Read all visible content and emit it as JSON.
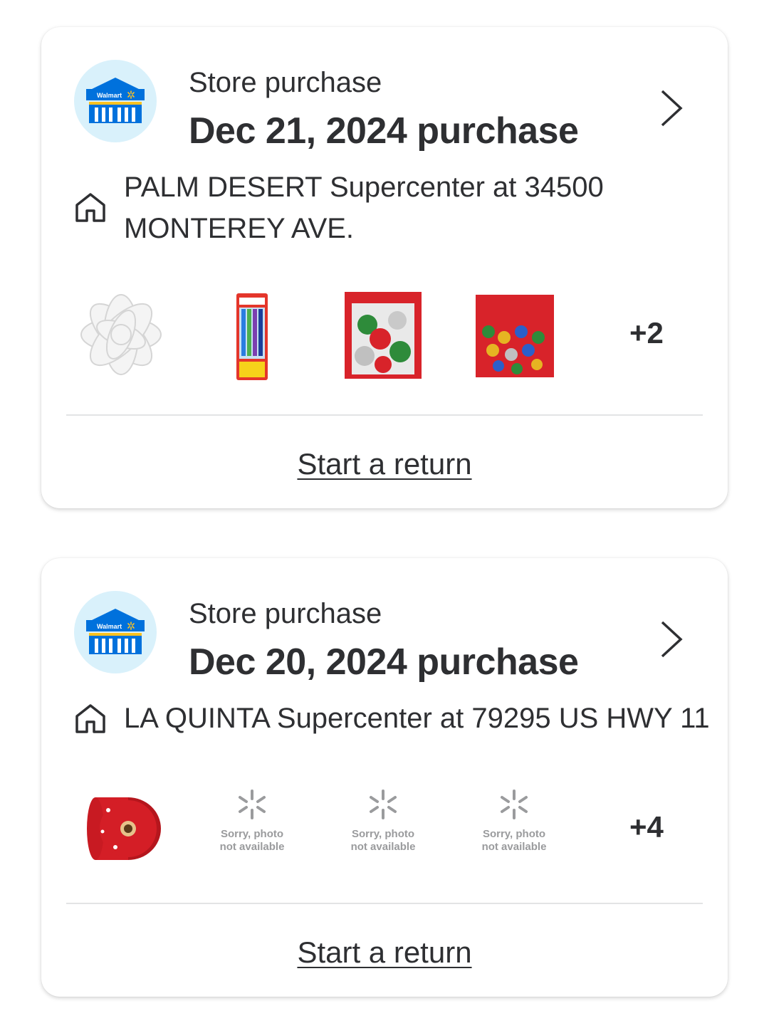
{
  "purchases": [
    {
      "type_label": "Store purchase",
      "title": "Dec 21, 2024 purchase",
      "store_address": "PALM DESERT Supercenter at 34500 MONTEREY AVE.",
      "store_logo_text": "Walmart",
      "items": [
        {
          "kind": "photo",
          "icon": "white-gift-bow-image"
        },
        {
          "kind": "photo",
          "icon": "toothbrush-pack-image"
        },
        {
          "kind": "photo",
          "icon": "gift-bows-bag-image"
        },
        {
          "kind": "photo",
          "icon": "gift-bows-bag-image"
        }
      ],
      "more_items": "+2",
      "return_label": "Start a return"
    },
    {
      "type_label": "Store purchase",
      "title": "Dec 20, 2024 purchase",
      "store_address": "LA QUINTA Supercenter at 79295 US HWY 11",
      "store_logo_text": "Walmart",
      "items": [
        {
          "kind": "photo",
          "icon": "red-ribbon-roll-image"
        },
        {
          "kind": "placeholder",
          "text_line1": "Sorry, photo",
          "text_line2": "not available"
        },
        {
          "kind": "placeholder",
          "text_line1": "Sorry, photo",
          "text_line2": "not available"
        },
        {
          "kind": "placeholder",
          "text_line1": "Sorry, photo",
          "text_line2": "not available"
        }
      ],
      "more_items": "+4",
      "return_label": "Start a return"
    }
  ],
  "colors": {
    "text": "#2e2f32",
    "avatar_bg": "#d9f1fb",
    "walmart_blue": "#0071dc",
    "walmart_yellow": "#ffc220",
    "placeholder_gray": "#9a9b9d"
  }
}
